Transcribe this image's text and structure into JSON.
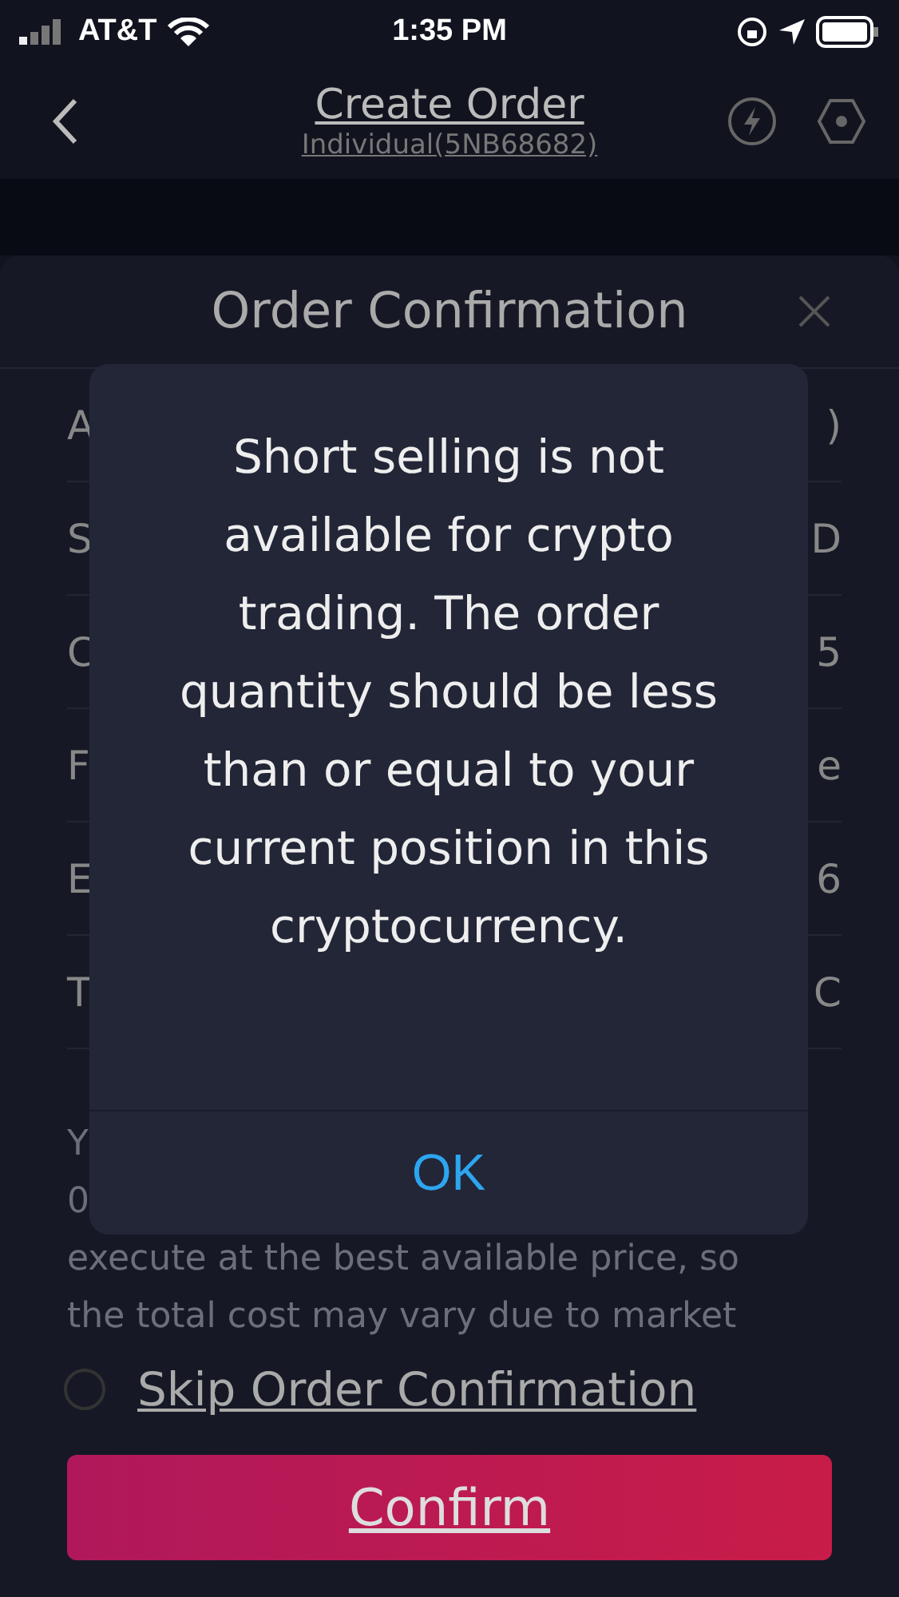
{
  "status_bar": {
    "carrier": "AT&T",
    "time": "1:35 PM"
  },
  "nav": {
    "title": "Create Order",
    "subtitle": "Individual(5NB68682)"
  },
  "sheet": {
    "title": "Order Confirmation",
    "rows": [
      {
        "label": "A",
        "value": ")"
      },
      {
        "label": "S",
        "value": "D"
      },
      {
        "label": "C",
        "value": "5"
      },
      {
        "label": "F",
        "value": "e"
      },
      {
        "label": "E",
        "value": "6"
      },
      {
        "label": "T",
        "value": "C"
      }
    ],
    "note_lines": [
      "Y",
      "0",
      "execute at the best available price, so",
      "the total cost may vary due to market"
    ],
    "skip_option": {
      "label": "Skip Order Confirmation",
      "checked": false
    },
    "confirm_button": "Confirm"
  },
  "alert": {
    "message": "Short selling is not available for crypto trading. The order quantity should be less than or equal to your current position in this cryptocurrency.",
    "button": "OK"
  }
}
